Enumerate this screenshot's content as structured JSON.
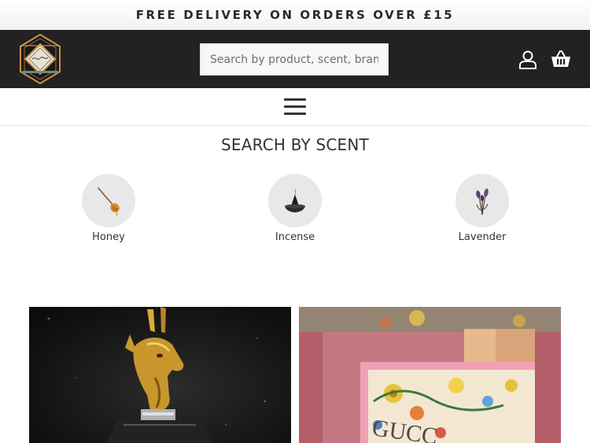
{
  "promo": {
    "text": "FREE DELIVERY ON ORDERS OVER £15"
  },
  "header": {
    "logo_icon": "brand-logo",
    "search": {
      "placeholder": "Search by product, scent, brand..",
      "value": ""
    },
    "account_icon": "user-icon",
    "basket_icon": "basket-icon",
    "background_color": "#222222"
  },
  "nav": {
    "menu_icon": "hamburger-menu-icon"
  },
  "scents": {
    "title": "SEARCH BY SCENT",
    "items": [
      {
        "label": "Honey",
        "icon": "honey-dipper-icon"
      },
      {
        "label": "Incense",
        "icon": "incense-cone-icon"
      },
      {
        "label": "Lavender",
        "icon": "lavender-sprig-icon"
      }
    ]
  },
  "products": [
    {
      "image": "gold-stag-head-perfume-bottle"
    },
    {
      "image": "pink-gucci-flora-perfume-bottle"
    }
  ]
}
